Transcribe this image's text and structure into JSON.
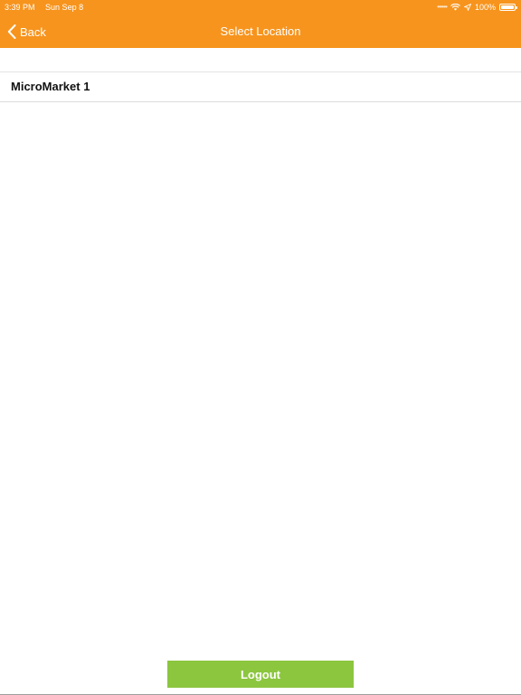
{
  "status_bar": {
    "time": "3:39 PM",
    "date": "Sun Sep 8",
    "battery": "100%",
    "battery_level": 1.0,
    "icons": [
      "signal-dots-icon",
      "wifi-icon",
      "location-arrow-icon",
      "battery-icon"
    ]
  },
  "nav": {
    "back_label": "Back",
    "back_icon": "chevron-left-icon",
    "title": "Select Location"
  },
  "locations": [
    {
      "label": "MicroMarket 1"
    }
  ],
  "footer": {
    "logout_label": "Logout"
  },
  "colors": {
    "header": "#f7941d",
    "logout": "#8cc63f",
    "text": "#111111",
    "header_text": "#ffffff"
  }
}
